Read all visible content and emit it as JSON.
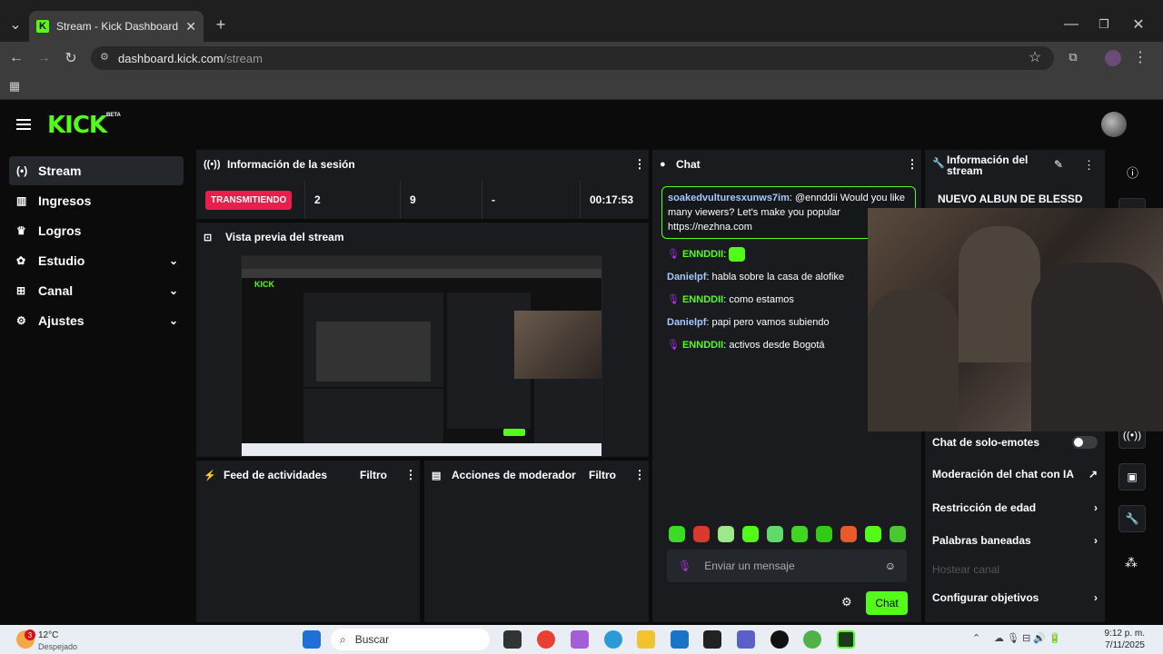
{
  "browser": {
    "tab_title": "Stream - Kick Dashboard",
    "url_host": "dashboard.kick.com",
    "url_path": "/stream"
  },
  "header": {
    "logo": "KICK",
    "beta": "BETA"
  },
  "sidebar": {
    "items": [
      {
        "label": "Stream",
        "icon": "broadcast-icon"
      },
      {
        "label": "Ingresos",
        "icon": "chart-icon"
      },
      {
        "label": "Logros",
        "icon": "trophy-icon"
      },
      {
        "label": "Estudio",
        "icon": "palette-icon"
      },
      {
        "label": "Canal",
        "icon": "channel-icon"
      },
      {
        "label": "Ajustes",
        "icon": "gear-icon"
      }
    ]
  },
  "session": {
    "title": "Información de la sesión",
    "status": "TRANSMITIENDO",
    "viewers": "2",
    "followers": "9",
    "subs": "-",
    "duration": "00:17:53"
  },
  "preview": {
    "title": "Vista previa del stream"
  },
  "activity": {
    "title": "Feed de actividades",
    "filter": "Filtro"
  },
  "modactions": {
    "title": "Acciones de moderador",
    "filter": "Filtro"
  },
  "chat": {
    "title": "Chat",
    "highlight_user": "soakedvulturesxunws7im",
    "highlight_text": "@ennddii Would you like many viewers? Let's make you popular https://nezhna.com",
    "messages": [
      {
        "user": "ENNDDII",
        "text": ""
      },
      {
        "user": "Danielpf",
        "text": "habla sobre la casa de alofike"
      },
      {
        "user": "ENNDDII",
        "text": "como estamos"
      },
      {
        "user": "Danielpf",
        "text": "papi pero vamos subiendo"
      },
      {
        "user": "ENNDDII",
        "text": "activos desde Bogotá"
      }
    ],
    "input_placeholder": "Enviar un mensaje",
    "send_label": "Chat"
  },
  "stream_info": {
    "title_line1": "Información del",
    "title_line2": "stream",
    "stream_title": "NUEVO ALBUN DE BLESSD"
  },
  "chat_settings": {
    "emotes_only": "Chat de solo-emotes",
    "ai_moderation": "Moderación del chat con IA",
    "age_restriction": "Restricción de edad",
    "banned_words": "Palabras baneadas",
    "host_channel": "Hostear canal",
    "goals": "Configurar objetivos"
  },
  "taskbar": {
    "weather_temp": "12°C",
    "weather_desc": "Despejado",
    "search": "Buscar",
    "time": "9:12 p. m.",
    "date": "7/11/2025",
    "badge": "3"
  },
  "colors": {
    "accent": "#53fc18",
    "live": "#e91e4a",
    "panel": "#191b1f"
  }
}
